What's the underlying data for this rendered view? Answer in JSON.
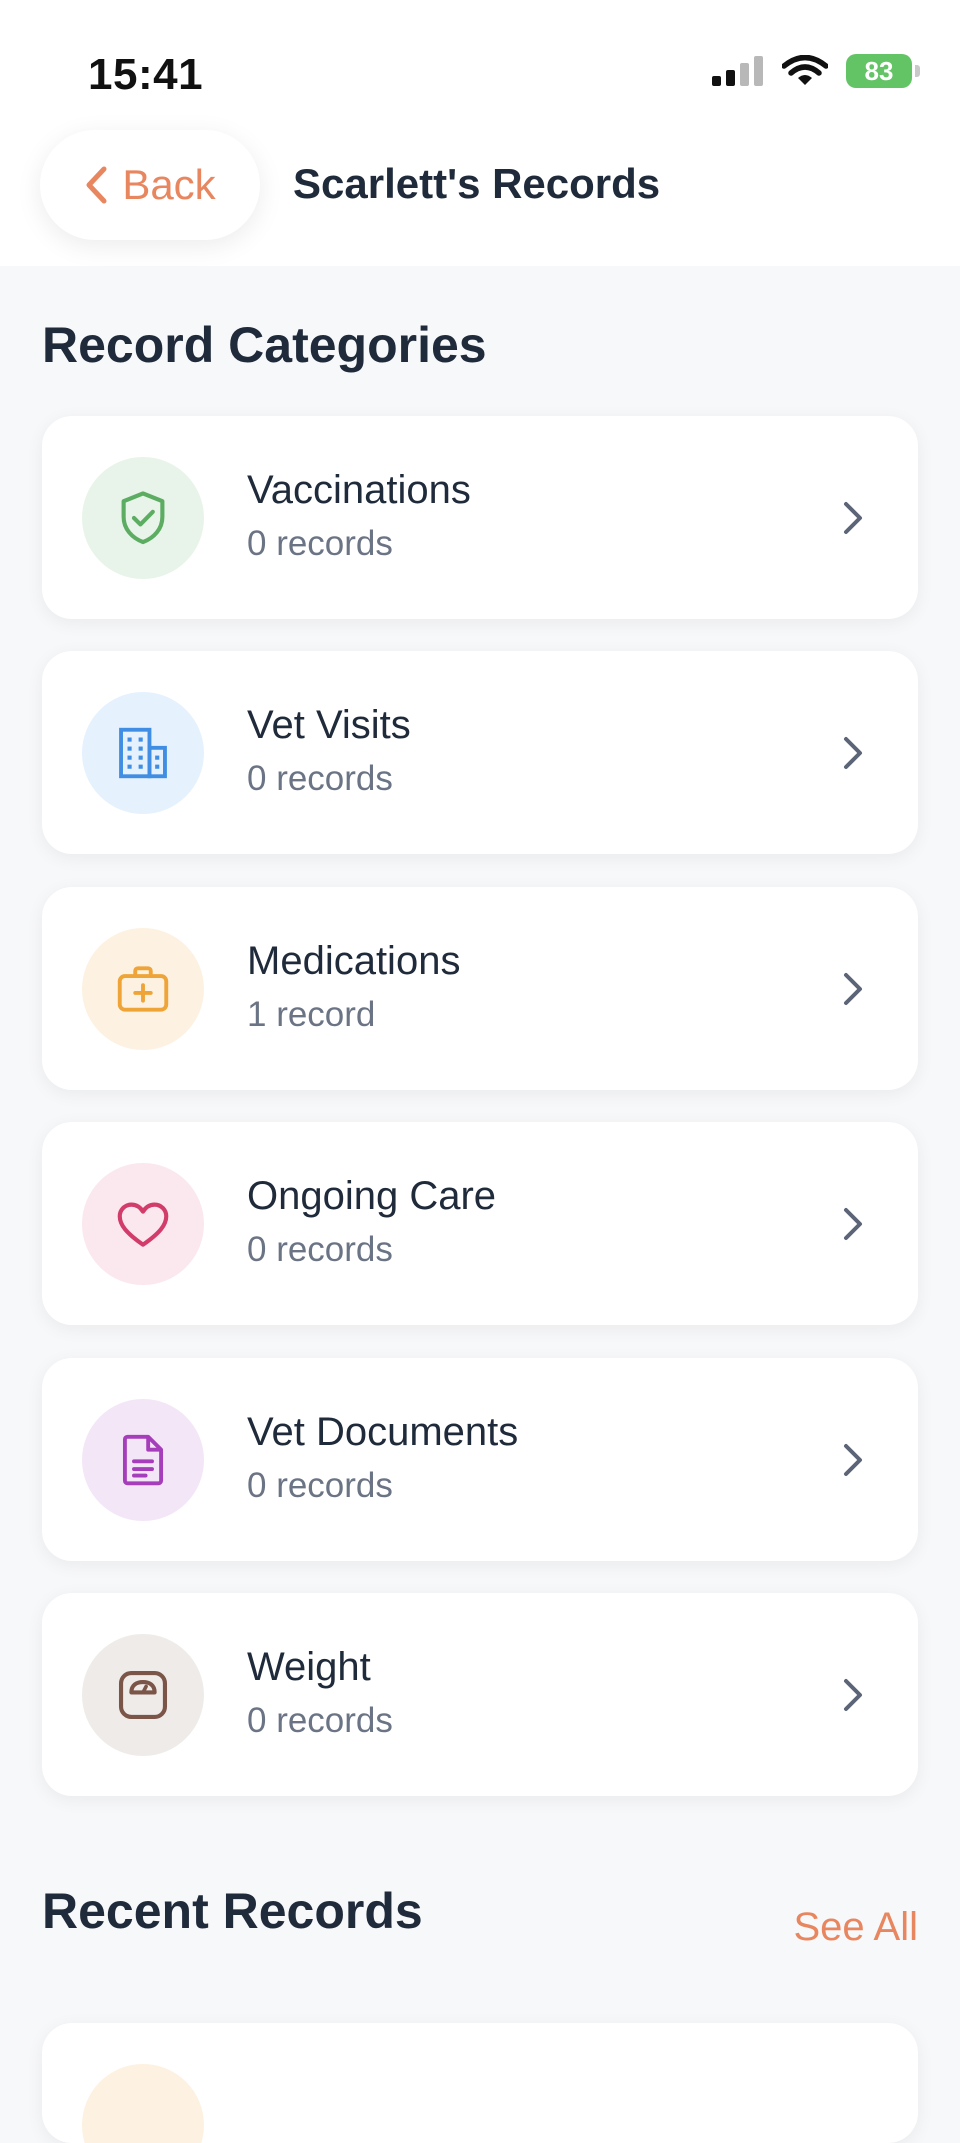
{
  "status_bar": {
    "time": "15:41",
    "battery": "83"
  },
  "nav": {
    "back_label": "Back",
    "title": "Scarlett's Records"
  },
  "sections": {
    "categories_title": "Record Categories",
    "recent_title": "Recent Records",
    "see_all_label": "See All"
  },
  "categories": [
    {
      "label": "Vaccinations",
      "count": "0 records",
      "icon": "shield-check-icon",
      "bg": "#e8f4e9",
      "color": "#5cad62"
    },
    {
      "label": "Vet Visits",
      "count": "0 records",
      "icon": "building-icon",
      "bg": "#e5f1fd",
      "color": "#3f8ee3"
    },
    {
      "label": "Medications",
      "count": "1 record",
      "icon": "medkit-icon",
      "bg": "#fdf1e1",
      "color": "#eea437"
    },
    {
      "label": "Ongoing Care",
      "count": "0 records",
      "icon": "heart-icon",
      "bg": "#fbe7ee",
      "color": "#d13c6a"
    },
    {
      "label": "Vet Documents",
      "count": "0 records",
      "icon": "document-icon",
      "bg": "#f3e6f7",
      "color": "#a63dba"
    },
    {
      "label": "Weight",
      "count": "0 records",
      "icon": "scale-icon",
      "bg": "#efebe9",
      "color": "#7a5548"
    }
  ],
  "colors": {
    "accent": "#e8875f",
    "background": "#f7f8fa",
    "text": "#1f2a3a",
    "muted": "#6b7485"
  }
}
